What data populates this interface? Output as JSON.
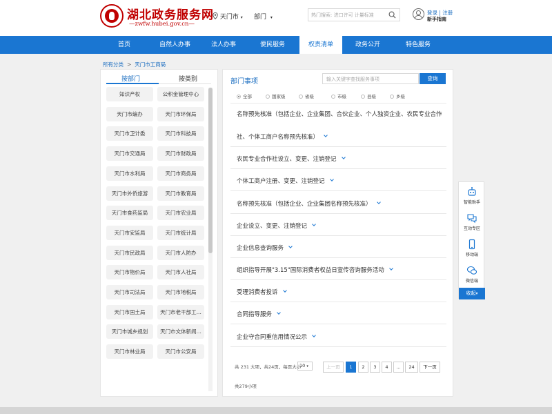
{
  "header": {
    "logo_title": "湖北政务服务网",
    "logo_sub": "—zwfw.hubei.gov.cn—",
    "location": "天门市",
    "dept_label": "部门",
    "search_placeholder": "热门搜索: 进口许可 计量标准",
    "login": "登录 | 注册",
    "guide": "新手指南"
  },
  "nav": {
    "items": [
      "首页",
      "自然人办事",
      "法人办事",
      "便民服务",
      "权责清单",
      "政务公开",
      "特色服务"
    ],
    "active": "权责清单"
  },
  "breadcrumb": {
    "root": "所有分类",
    "sep": ">",
    "current": "天门市工商局"
  },
  "left_tabs": {
    "by_dept": "按部门",
    "by_type": "按类别"
  },
  "departments": [
    "知识产权",
    "公积金管理中心",
    "天门市编办",
    "天门市环保局",
    "天门市卫计委",
    "天门市科技局",
    "天门市交通局",
    "天门市财政局",
    "天门市水利局",
    "天门市商务局",
    "天门市外侨旅游",
    "天门市教育局",
    "天门市食药监局",
    "天门市农业局",
    "天门市安监局",
    "天门市统计局",
    "天门市民政局",
    "天门市人防办",
    "天门市物价局",
    "天门市人社局",
    "天门市司法局",
    "天门市地税局",
    "天门市国土局",
    "天门市老干部工...",
    "天门市城乡规划",
    "天门市文体新闻...",
    "天门市林业局",
    "天门市公安局"
  ],
  "right": {
    "title": "部门事项",
    "search_placeholder": "输入关键字查找服务事项",
    "search_btn": "查询",
    "levels": [
      "全部",
      "国家级",
      "省级",
      "市级",
      "县级",
      "乡级"
    ],
    "level_selected": "全部"
  },
  "items": [
    "名称预先核准（包括企业、企业集团、合伙企业、个人独资企业、农民专业合作",
    "社、个体工商户名称预先核准）",
    "农民专业合作社设立、变更、注销登记",
    "个体工商户注册、变更、注销登记",
    "名称预先核准（包括企业、企业集团名称预先核准）",
    "企业设立、变更、注销登记",
    "企业信息查询服务",
    "组织指导开展\"3.15\"国际消费者权益日宣传咨询服务活动",
    "受理消费者投诉",
    "合同指导服务",
    "企业守合同重信用情况公示"
  ],
  "pager": {
    "info": "共 231 大项，共24页，每页大小",
    "page_size": "10",
    "prev": "上一页",
    "pages": [
      "1",
      "2",
      "3",
      "4",
      "...",
      "24"
    ],
    "current": "1",
    "next": "下一页",
    "total_small": "共279小项"
  },
  "float_bar": {
    "items": [
      "智能助手",
      "互动专区",
      "移动端",
      "微信端"
    ],
    "collapse": "收起"
  }
}
